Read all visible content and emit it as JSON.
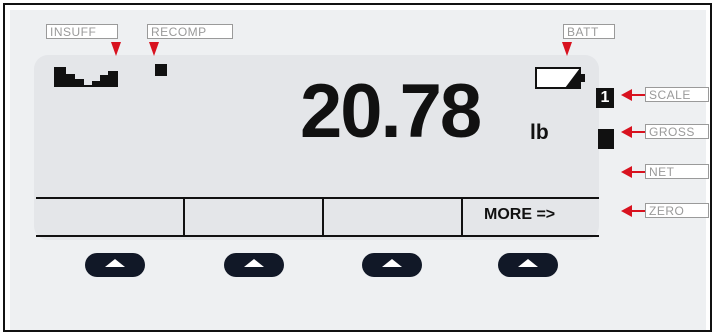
{
  "weight_display": {
    "value": "20.78",
    "unit": "lb",
    "scale_number": "1"
  },
  "softkeys": {
    "labels": [
      "",
      "",
      "",
      "MORE =>"
    ]
  },
  "callouts": {
    "insuff": "INSUFF",
    "recomp": "RECOMP",
    "batt": "BATT",
    "scale": "SCALE",
    "gross": "GROSS",
    "net": "NET",
    "zero": "ZERO"
  },
  "colors": {
    "arrow": "#d8121f",
    "lcd_background": "#e4e6e9",
    "panel_background": "#eef0f2",
    "callout_text": "#9a9a9a",
    "button": "#111827"
  }
}
